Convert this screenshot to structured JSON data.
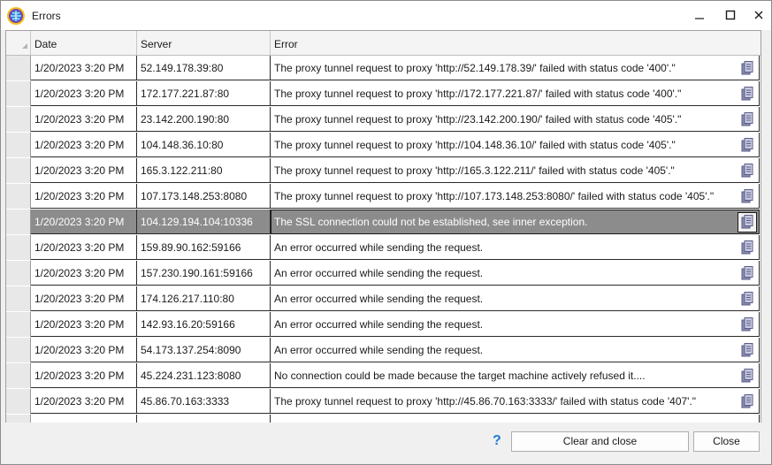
{
  "window": {
    "title": "Errors",
    "colors": {
      "accent": "#1e7bd4",
      "selected_row": "#8c8c8c",
      "copy_icon": "#6a6c9a"
    }
  },
  "grid": {
    "columns": [
      "Date",
      "Server",
      "Error"
    ],
    "selected_index": 6,
    "rows": [
      {
        "date": "1/20/2023 3:20 PM",
        "server": "52.149.178.39:80",
        "error": "The proxy tunnel request to proxy 'http://52.149.178.39/' failed with status code '400'.\""
      },
      {
        "date": "1/20/2023 3:20 PM",
        "server": "172.177.221.87:80",
        "error": "The proxy tunnel request to proxy 'http://172.177.221.87/' failed with status code '400'.\""
      },
      {
        "date": "1/20/2023 3:20 PM",
        "server": "23.142.200.190:80",
        "error": "The proxy tunnel request to proxy 'http://23.142.200.190/' failed with status code '405'.\""
      },
      {
        "date": "1/20/2023 3:20 PM",
        "server": "104.148.36.10:80",
        "error": "The proxy tunnel request to proxy 'http://104.148.36.10/' failed with status code '405'.\""
      },
      {
        "date": "1/20/2023 3:20 PM",
        "server": "165.3.122.211:80",
        "error": "The proxy tunnel request to proxy 'http://165.3.122.211/' failed with status code '405'.\""
      },
      {
        "date": "1/20/2023 3:20 PM",
        "server": "107.173.148.253:8080",
        "error": "The proxy tunnel request to proxy 'http://107.173.148.253:8080/' failed with status code '405'.\""
      },
      {
        "date": "1/20/2023 3:20 PM",
        "server": "104.129.194.104:10336",
        "error": "The SSL connection could not be established, see inner exception."
      },
      {
        "date": "1/20/2023 3:20 PM",
        "server": "159.89.90.162:59166",
        "error": "An error occurred while sending the request."
      },
      {
        "date": "1/20/2023 3:20 PM",
        "server": "157.230.190.161:59166",
        "error": "An error occurred while sending the request."
      },
      {
        "date": "1/20/2023 3:20 PM",
        "server": "174.126.217.110:80",
        "error": "An error occurred while sending the request."
      },
      {
        "date": "1/20/2023 3:20 PM",
        "server": "142.93.16.20:59166",
        "error": "An error occurred while sending the request."
      },
      {
        "date": "1/20/2023 3:20 PM",
        "server": "54.173.137.254:8090",
        "error": "An error occurred while sending the request."
      },
      {
        "date": "1/20/2023 3:20 PM",
        "server": "45.224.231.123:8080",
        "error": "No connection could be made because the target machine actively refused it...."
      },
      {
        "date": "1/20/2023 3:20 PM",
        "server": "45.86.70.163:3333",
        "error": "The proxy tunnel request to proxy 'http://45.86.70.163:3333/' failed with status code '407'.\""
      },
      {
        "date": "",
        "server": "",
        "error": ""
      }
    ]
  },
  "footer": {
    "help_label": "?",
    "clear_label": "Clear and close",
    "close_label": "Close"
  },
  "icons": {
    "app": "globe-app-icon",
    "minimize": "minimize-icon",
    "maximize": "maximize-icon",
    "close": "close-icon",
    "row_copy": "copy-icon",
    "help": "help-icon"
  }
}
